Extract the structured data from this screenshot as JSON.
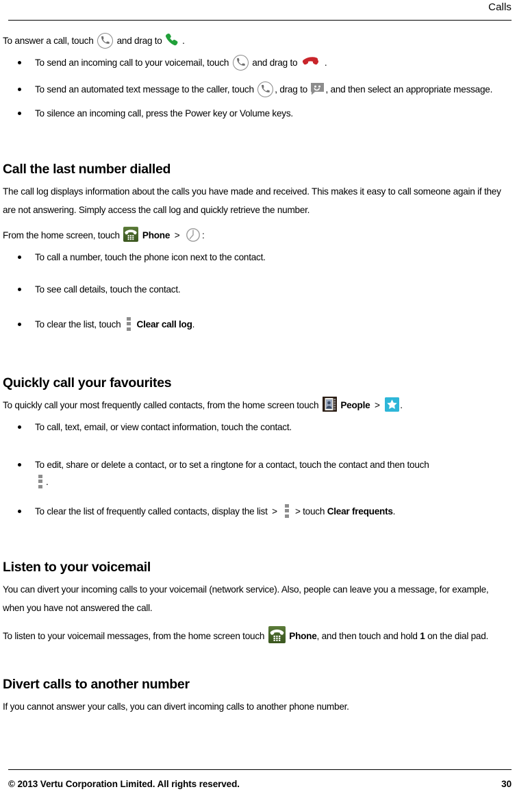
{
  "header": {
    "title": "Calls"
  },
  "footer": {
    "copyright": "© 2013 Vertu Corporation Limited. All rights reserved.",
    "page_number": "30"
  },
  "icons": {
    "call_circle": "call-circle-icon",
    "handset_green": "answer-call-handset-icon",
    "handset_red": "end-call-handset-icon",
    "message_bubble": "message-bubble-icon",
    "clock": "call-log-clock-icon",
    "phone_app": "phone-app-icon",
    "people_app": "people-app-icon",
    "star": "favourites-star-icon",
    "overflow_menu": "overflow-menu-icon"
  },
  "colors": {
    "handset_green": "#21a03a",
    "handset_red": "#c9252b",
    "message_gray": "#8d8d8d",
    "phone_app_green": "#49662c",
    "people_brown": "#2b1d14",
    "star_cyan": "#2eb6d8",
    "overflow_gray": "#8d8d8d"
  },
  "content": {
    "intro": {
      "before_icon": "To answer a call, touch",
      "mid": "and drag to",
      "after": "."
    },
    "intro_bullets": [
      {
        "parts": [
          {
            "type": "text",
            "value": "To send an incoming call to your voicemail, touch"
          },
          {
            "type": "icon",
            "value": "call-circle-icon"
          },
          {
            "type": "text",
            "value": "and drag to"
          },
          {
            "type": "icon",
            "value": "end-call-handset-icon"
          },
          {
            "type": "text",
            "value": "."
          }
        ]
      },
      {
        "parts": [
          {
            "type": "text",
            "value": "To send an automated text message to the caller, touch"
          },
          {
            "type": "icon",
            "value": "call-circle-icon"
          },
          {
            "type": "text",
            "value": ", drag to"
          },
          {
            "type": "icon",
            "value": "message-bubble-icon"
          },
          {
            "type": "text",
            "value": ", and then select an appropriate message."
          }
        ]
      },
      {
        "parts": [
          {
            "type": "text",
            "value": "To silence an incoming call, press the Power key or Volume keys."
          }
        ]
      }
    ],
    "sections": [
      {
        "heading": "Call the last number dialled",
        "paragraph": "The call log displays information about the calls you have made and received. This makes it easy to call someone again if they are not answering. Simply access the call log and quickly retrieve the number.",
        "lead_in": {
          "before": "From the home screen, touch",
          "app_label": "Phone",
          "separator": ">",
          "after": ":"
        },
        "bullets": [
          "To call a number, touch the phone icon next to the contact.",
          "To see call details, touch the contact.",
          "To clear the list, touch"
        ],
        "last_bullet_bold": "Clear call log",
        "last_bullet_tail": "."
      },
      {
        "heading": "Quickly call your favourites",
        "lead_in": {
          "before": "To quickly call your most frequently called contacts, from the home screen touch",
          "app_label": "People",
          "separator": ">",
          "after": "."
        },
        "bullets": [
          "To call, text, email, or view contact information, touch the contact.",
          "To edit, share or delete a contact, or to set a ringtone for a contact, touch the contact and then touch",
          "To clear the list of frequently called contacts, display the list"
        ],
        "bullet2_tail": ".",
        "bullet3_mid": ">",
        "bullet3_mid2": "> touch",
        "bullet3_bold": "Clear frequents",
        "bullet3_tail": "."
      },
      {
        "heading": "Listen to your voicemail",
        "paragraph": "You can divert your incoming calls to your voicemail (network service). Also, people can leave you a message, for example, when you have not answered the call.",
        "lead_in": {
          "before": "To listen to your voicemail messages, from the home screen touch",
          "app_label": "Phone",
          "after": ", and then touch and hold",
          "bold_key": "1",
          "tail": "on the dial pad."
        }
      },
      {
        "heading": "Divert calls to another number",
        "paragraph": "If you cannot answer your calls, you can divert incoming calls to another phone number."
      }
    ]
  }
}
